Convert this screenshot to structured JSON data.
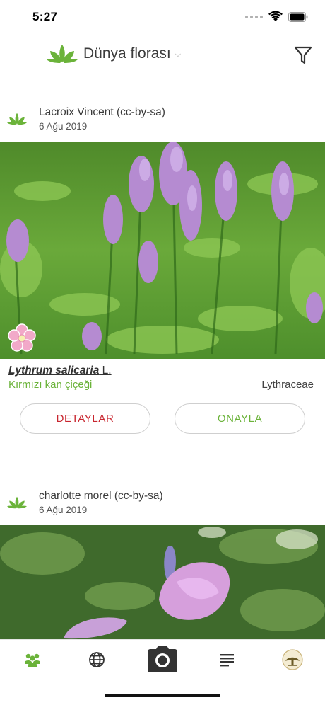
{
  "status": {
    "time": "5:27"
  },
  "header": {
    "title": "Dünya florası",
    "caret": "⌵"
  },
  "posts": [
    {
      "author": "Lacroix Vincent (cc-by-sa)",
      "date": "6 Ağu 2019",
      "genus_species": "Lythrum salicaria",
      "authority": "L.",
      "common_name": "Kırmızı kan çiçeği",
      "family": "Lythraceae",
      "details_label": "DETAYLAR",
      "confirm_label": "ONAYLA"
    },
    {
      "author": "charlotte morel (cc-by-sa)",
      "date": "6 Ağu 2019"
    }
  ],
  "colors": {
    "accent_green": "#6bb33a",
    "details_red": "#c8262f"
  },
  "tabs": [
    "community-icon",
    "globe-icon",
    "camera-icon",
    "list-icon",
    "profile-avatar-icon"
  ]
}
